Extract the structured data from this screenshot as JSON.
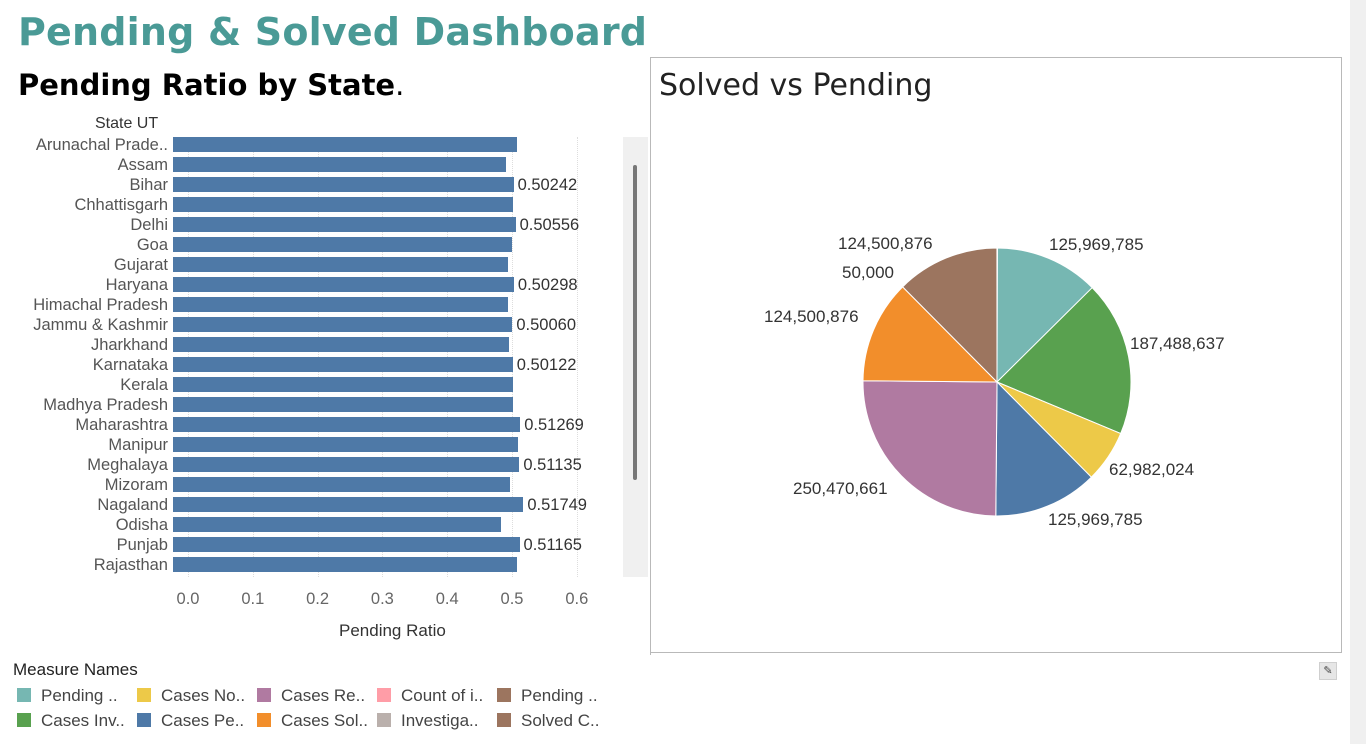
{
  "dashboard": {
    "title": "Pending & Solved Dashboard"
  },
  "bar_chart": {
    "title": "Pending Ratio by State",
    "title_suffix": ".",
    "row_header": "State UT",
    "x_title": "Pending Ratio",
    "x_ticks": [
      "0.0",
      "0.1",
      "0.2",
      "0.3",
      "0.4",
      "0.5",
      "0.6"
    ]
  },
  "pie_chart": {
    "title": "Solved vs Pending",
    "labels": [
      "125,969,785",
      "187,488,637",
      "62,982,024",
      "125,969,785",
      "250,470,661",
      "124,500,876",
      "124,500,876",
      "50,000"
    ]
  },
  "legend": {
    "title": "Measure Names",
    "items": [
      "Pending ..",
      "Cases No..",
      "Cases Re..",
      "Count of i..",
      "Pending ..",
      "Cases Inv..",
      "Cases Pe..",
      "Cases Sol..",
      "Investiga..",
      "Solved C.."
    ],
    "colors": [
      "#76b7b2",
      "#edc948",
      "#b07aa1",
      "#ff9da7",
      "#9c755f",
      "#59a14f",
      "#4e79a7",
      "#f28e2b",
      "#bab0ac",
      "#9c755f"
    ]
  },
  "chart_data": [
    {
      "type": "bar",
      "orientation": "horizontal",
      "title": "Pending Ratio by State",
      "ylabel": "State UT",
      "xlabel": "Pending Ratio",
      "xlim": [
        0,
        0.6
      ],
      "grid": true,
      "categories": [
        "Arunachal Prade..",
        "Assam",
        "Bihar",
        "Chhattisgarh",
        "Delhi",
        "Goa",
        "Gujarat",
        "Haryana",
        "Himachal Pradesh",
        "Jammu & Kashmir",
        "Jharkhand",
        "Karnataka",
        "Kerala",
        "Madhya Pradesh",
        "Maharashtra",
        "Manipur",
        "Meghalaya",
        "Mizoram",
        "Nagaland",
        "Odisha",
        "Punjab",
        "Rajasthan"
      ],
      "values": [
        0.508,
        0.49,
        0.50242,
        0.501,
        0.50556,
        0.5,
        0.494,
        0.50298,
        0.494,
        0.5006,
        0.496,
        0.50122,
        0.501,
        0.501,
        0.51269,
        0.51,
        0.51135,
        0.497,
        0.51749,
        0.483,
        0.51165,
        0.508
      ],
      "data_labels": [
        "",
        "",
        "0.50242",
        "",
        "0.50556",
        "",
        "",
        "0.50298",
        "",
        "0.50060",
        "",
        "0.50122",
        "",
        "",
        "0.51269",
        "",
        "0.51135",
        "",
        "0.51749",
        "",
        "0.51165",
        ""
      ],
      "color": "#4e79a7"
    },
    {
      "type": "pie",
      "title": "Solved vs Pending",
      "values": [
        125969785,
        187488637,
        62982024,
        125969785,
        250470661,
        124500876,
        124500876,
        50000
      ],
      "labels": [
        "125,969,785",
        "187,488,637",
        "62,982,024",
        "125,969,785",
        "250,470,661",
        "124,500,876",
        "124,500,876",
        "50,000"
      ],
      "colors": [
        "#76b7b2",
        "#59a14f",
        "#edc948",
        "#4e79a7",
        "#b07aa1",
        "#f28e2b",
        "#9c755f",
        "#e15759"
      ]
    }
  ]
}
